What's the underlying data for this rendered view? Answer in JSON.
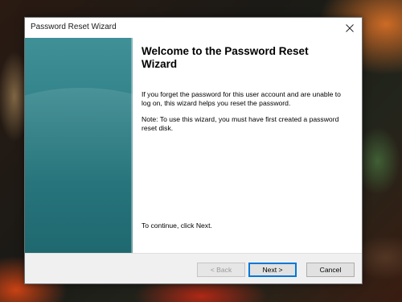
{
  "window": {
    "title": "Password Reset Wizard"
  },
  "icons": {
    "close": "close-icon"
  },
  "content": {
    "heading": "Welcome to the Password Reset Wizard",
    "paragraph1": "If you forget the password for this user account and are unable to log on, this wizard helps you reset the password.",
    "paragraph2": "Note: To use this wizard, you must have first created a password reset disk.",
    "paragraph3": "To continue, click Next."
  },
  "buttons": {
    "back": "< Back",
    "next": "Next >",
    "cancel": "Cancel"
  },
  "colors": {
    "sidebar": "#2f7f86",
    "accent": "#0078d7",
    "footer": "#f0f0f0"
  }
}
